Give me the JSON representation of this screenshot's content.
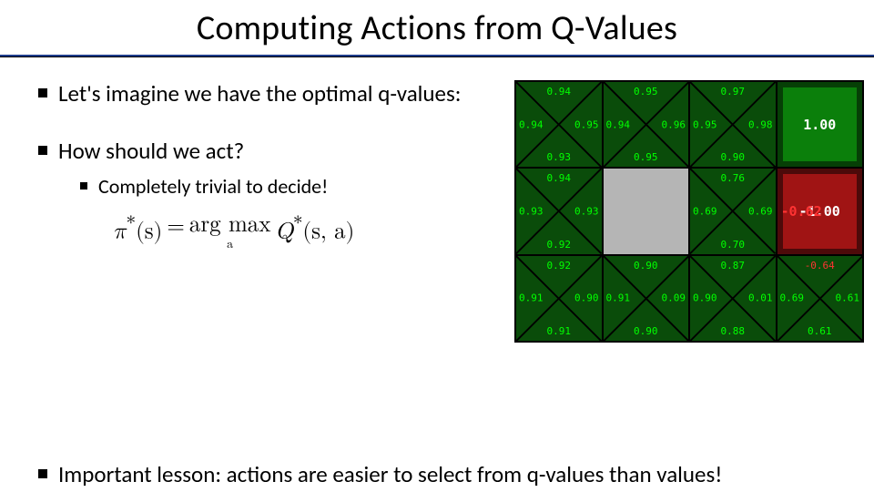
{
  "title": "Computing Actions from Q-Values",
  "bullets": {
    "b1": "Let's imagine we have the optimal q-values:",
    "b2": "How should we act?",
    "b2_sub1": "Completely trivial to decide!",
    "lesson": "Important lesson: actions are easier to select from q-values than values!"
  },
  "formula": {
    "lhs_pi": "π",
    "lhs_star": "*",
    "lhs_s": "(s)",
    "eq": " = ",
    "argmax": "arg max",
    "argmax_sub": "a",
    "Q": "Q",
    "Q_star": "*",
    "Q_args": "(s, a)"
  },
  "grid": {
    "rows": 3,
    "cols": 4,
    "cells": [
      [
        {
          "type": "q",
          "n": "0.94",
          "e": "0.95",
          "s": "0.93",
          "w": "0.94"
        },
        {
          "type": "q",
          "n": "0.95",
          "e": "0.96",
          "s": "0.95",
          "w": "0.94"
        },
        {
          "type": "q",
          "n": "0.97",
          "e": "0.98",
          "s": "0.90",
          "w": "0.95"
        },
        {
          "type": "terminal-good",
          "value": "1.00"
        }
      ],
      [
        {
          "type": "q",
          "n": "0.94",
          "e": "0.93",
          "s": "0.92",
          "w": "0.93"
        },
        {
          "type": "wall"
        },
        {
          "type": "q",
          "n": "0.76",
          "e": "0.69",
          "s": "0.70",
          "w": "0.69",
          "e_neg": false
        },
        {
          "type": "terminal-bad",
          "value": "-1.00",
          "w": "-0.62",
          "w_neg": true
        }
      ],
      [
        {
          "type": "q",
          "n": "0.92",
          "e": "0.90",
          "s": "0.91",
          "w": "0.91"
        },
        {
          "type": "q",
          "n": "0.90",
          "e": "0.09",
          "s": "0.90",
          "w": "0.91"
        },
        {
          "type": "q",
          "n": "0.87",
          "e": "0.01",
          "s": "0.88",
          "w": "0.90"
        },
        {
          "type": "q",
          "n": "-0.64",
          "n_neg": true,
          "e": "0.61",
          "s": "0.61",
          "w": "0.69"
        }
      ]
    ]
  }
}
